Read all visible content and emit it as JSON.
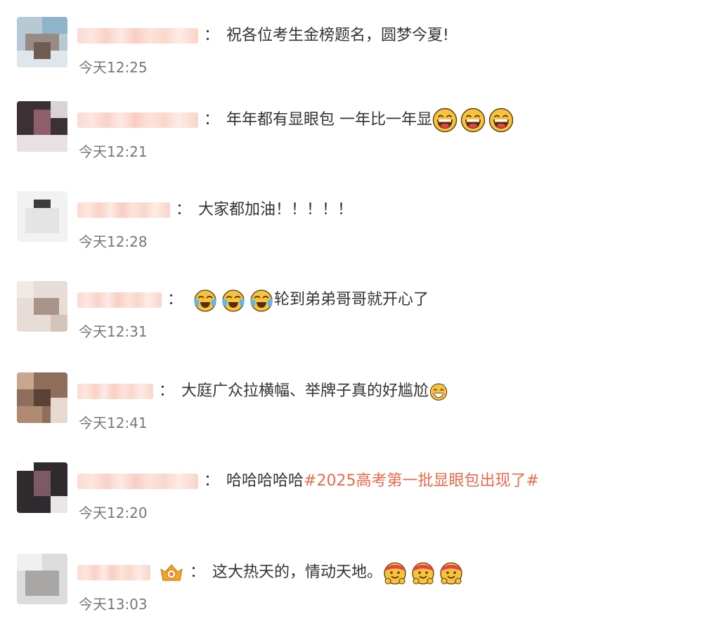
{
  "comments": [
    {
      "separator": "：",
      "text": "祝各位考生金榜题名，圆梦今夏!",
      "time": "今天12:25"
    },
    {
      "separator": "：",
      "text": "年年都有显眼包 一年比一年显",
      "time": "今天12:21"
    },
    {
      "separator": "：",
      "text": "大家都加油！！！！！",
      "time": "今天12:28"
    },
    {
      "separator": "：",
      "text": "轮到弟弟哥哥就开心了",
      "time": "今天12:31"
    },
    {
      "separator": "：",
      "text": "大庭广众拉横幅、举牌子真的好尴尬",
      "time": "今天12:41"
    },
    {
      "separator": "：",
      "text": "哈哈哈哈哈",
      "topic": "#2025高考第一批显眼包出现了#",
      "time": "今天12:20"
    },
    {
      "separator": "：",
      "text": "这大热天的，情动天地。",
      "time": "今天13:03"
    }
  ],
  "icons": {
    "c2_emojis": [
      "laughing-emoji-icon",
      "laughing-emoji-icon",
      "laughing-emoji-icon"
    ],
    "c4_emojis": [
      "crying-laughing-emoji-icon",
      "crying-laughing-emoji-icon",
      "crying-laughing-emoji-icon"
    ],
    "c5_emoji": "awkward-sweat-emoji-icon",
    "c7_badge": "fan-crown-badge-icon",
    "c7_emojis": [
      "cheering-headband-emoji-icon",
      "cheering-headband-emoji-icon",
      "cheering-headband-emoji-icon"
    ]
  },
  "colors": {
    "text": "#333333",
    "time": "#777777",
    "topic": "#e8694a",
    "nickname_blur": "#fbd6cc"
  }
}
